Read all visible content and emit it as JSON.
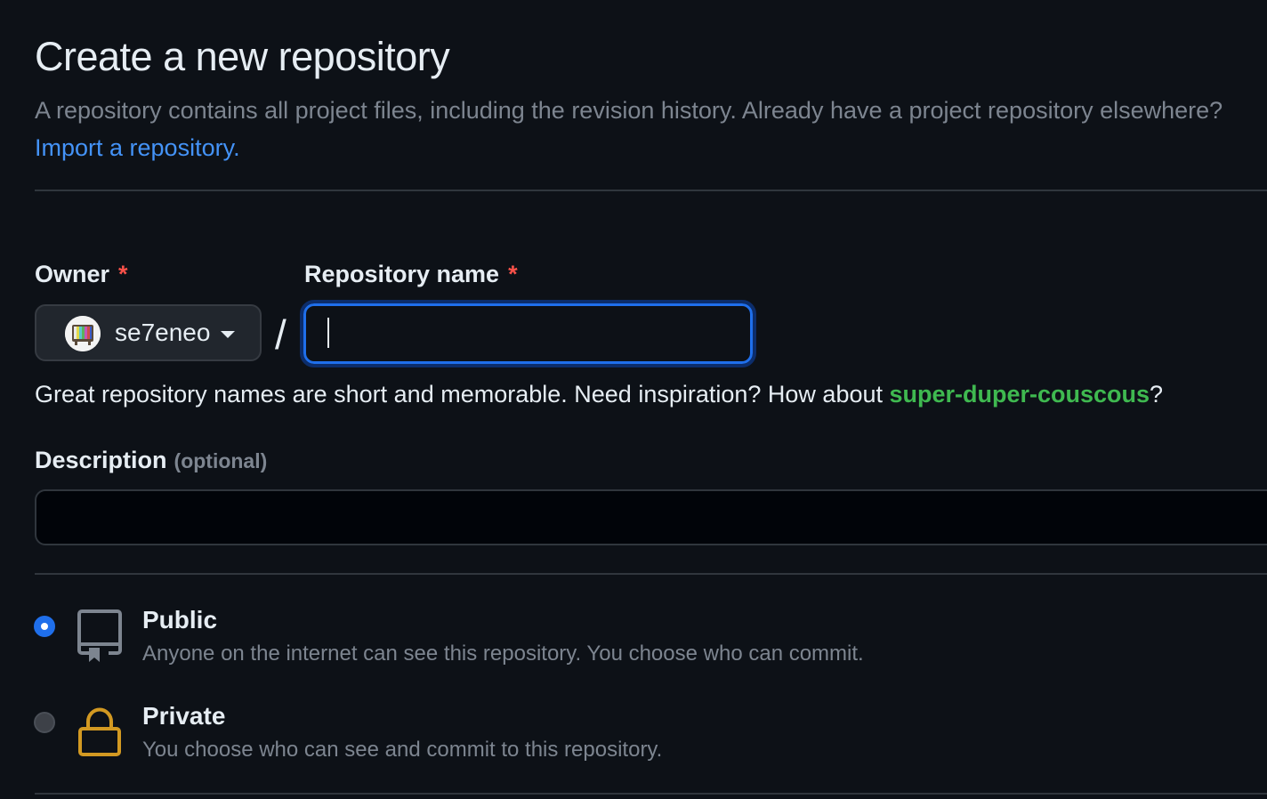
{
  "header": {
    "title": "Create a new repository",
    "subtitle_text": "A repository contains all project files, including the revision history. Already have a project repository elsewhere?",
    "import_link": "Import a repository."
  },
  "owner": {
    "label": "Owner",
    "required_mark": "*",
    "selected": "se7eneo"
  },
  "separator": "/",
  "repo_name": {
    "label": "Repository name",
    "required_mark": "*",
    "value": "",
    "focused": true
  },
  "hint": {
    "text": "Great repository names are short and memorable. Need inspiration? How about ",
    "suggestion": "super-duper-couscous",
    "suffix": "?"
  },
  "description": {
    "label": "Description",
    "optional": "(optional)",
    "value": ""
  },
  "visibility": {
    "options": [
      {
        "title": "Public",
        "description": "Anyone on the internet can see this repository. You choose who can commit.",
        "icon": "repo-icon",
        "checked": true
      },
      {
        "title": "Private",
        "description": "You choose who can see and commit to this repository.",
        "icon": "lock-icon",
        "checked": false
      }
    ]
  },
  "colors": {
    "background": "#0d1117",
    "accent": "#1f6feb",
    "link": "#4493f8",
    "suggestion": "#3fb950",
    "required": "#f85149",
    "lock": "#d29922"
  }
}
